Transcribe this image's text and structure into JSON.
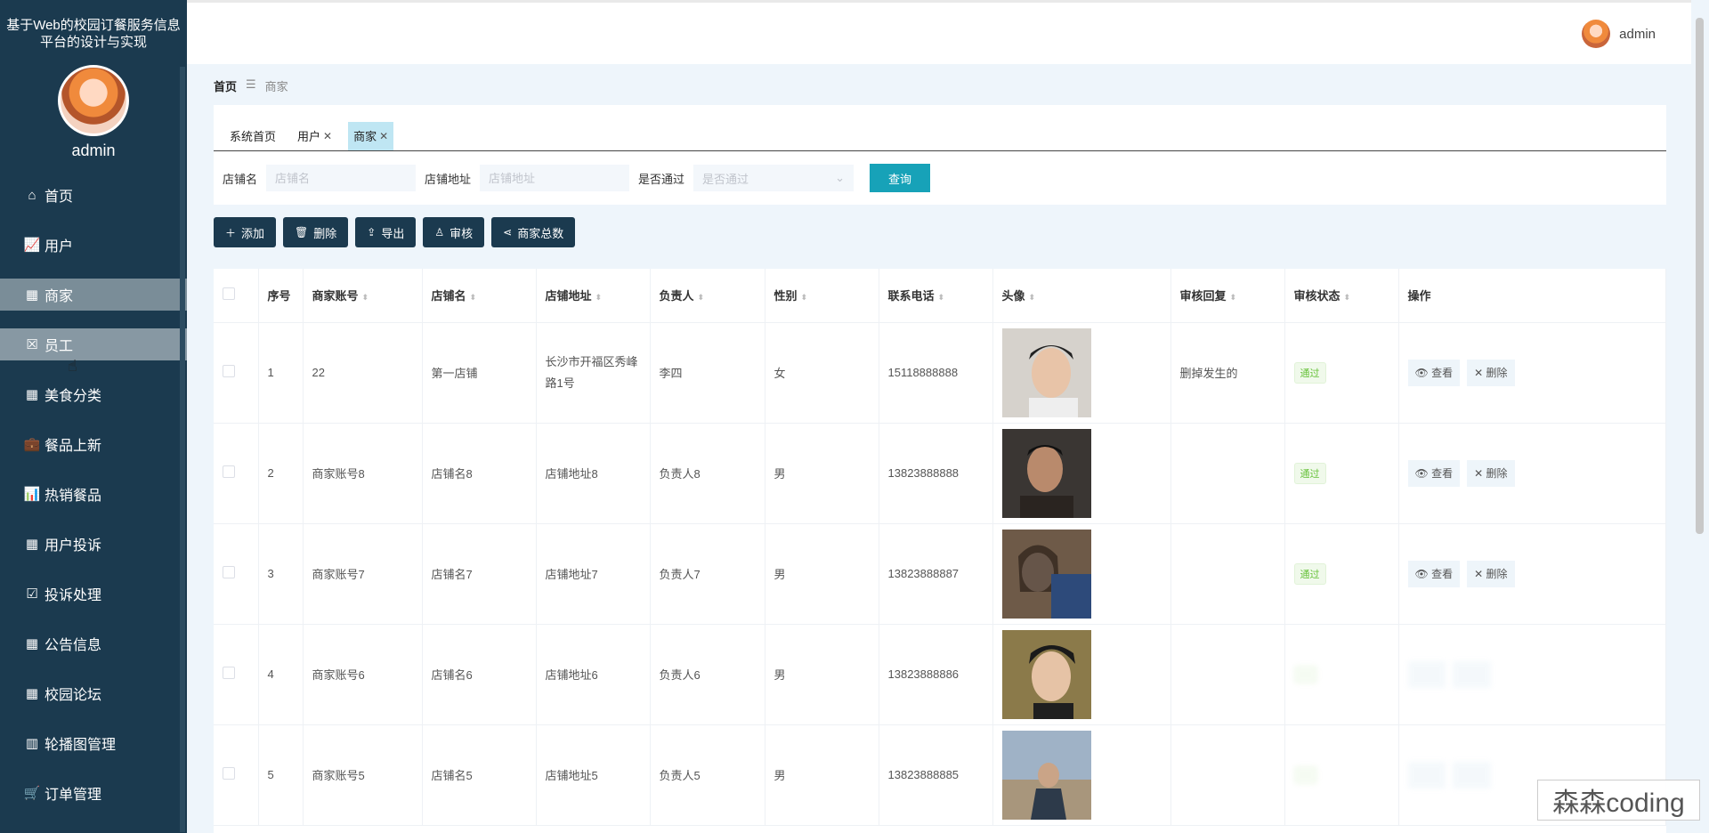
{
  "app": {
    "title": "基于Web的校园订餐服务信息平台的设计与实现",
    "username": "admin"
  },
  "sidebar": {
    "items": [
      {
        "label": "首页",
        "icon": "home-icon"
      },
      {
        "label": "用户",
        "icon": "chart-icon"
      },
      {
        "label": "商家",
        "icon": "grid-icon"
      },
      {
        "label": "员工",
        "icon": "clipboard-icon"
      },
      {
        "label": "美食分类",
        "icon": "grid-icon"
      },
      {
        "label": "餐品上新",
        "icon": "briefcase-icon"
      },
      {
        "label": "热销餐品",
        "icon": "bar-chart-icon"
      },
      {
        "label": "用户投诉",
        "icon": "grid-icon"
      },
      {
        "label": "投诉处理",
        "icon": "check-clipboard-icon"
      },
      {
        "label": "公告信息",
        "icon": "grid-icon"
      },
      {
        "label": "校园论坛",
        "icon": "grid-icon"
      },
      {
        "label": "轮播图管理",
        "icon": "book-icon"
      },
      {
        "label": "订单管理",
        "icon": "cart-icon"
      }
    ]
  },
  "topbar": {
    "username": "admin"
  },
  "breadcrumb": {
    "home": "首页",
    "separator": "☰",
    "current": "商家"
  },
  "tabs": [
    {
      "label": "系统首页",
      "closable": false
    },
    {
      "label": "用户",
      "closable": true
    },
    {
      "label": "商家",
      "closable": true,
      "active": true
    }
  ],
  "search": {
    "shop_name_label": "店铺名",
    "shop_name_placeholder": "店铺名",
    "address_label": "店铺地址",
    "address_placeholder": "店铺地址",
    "approved_label": "是否通过",
    "approved_placeholder": "是否通过",
    "query_button": "查询"
  },
  "actions": {
    "add": "添加",
    "delete": "删除",
    "export": "导出",
    "review": "审核",
    "total": "商家总数"
  },
  "table": {
    "headers": [
      "序号",
      "商家账号",
      "店铺名",
      "店铺地址",
      "负责人",
      "性别",
      "联系电话",
      "头像",
      "审核回复",
      "审核状态",
      "操作"
    ],
    "view_label": "查看",
    "delete_label": "删除",
    "rows": [
      {
        "no": "1",
        "account": "22",
        "shop": "第一店铺",
        "address": "长沙市开福区秀峰路1号",
        "owner": "李四",
        "gender": "女",
        "phone": "15118888888",
        "reply": "删掉发生的",
        "status": "通过"
      },
      {
        "no": "2",
        "account": "商家账号8",
        "shop": "店铺名8",
        "address": "店铺地址8",
        "owner": "负责人8",
        "gender": "男",
        "phone": "13823888888",
        "reply": "",
        "status": "通过"
      },
      {
        "no": "3",
        "account": "商家账号7",
        "shop": "店铺名7",
        "address": "店铺地址7",
        "owner": "负责人7",
        "gender": "男",
        "phone": "13823888887",
        "reply": "",
        "status": "通过"
      },
      {
        "no": "4",
        "account": "商家账号6",
        "shop": "店铺名6",
        "address": "店铺地址6",
        "owner": "负责人6",
        "gender": "男",
        "phone": "13823888886",
        "reply": "",
        "status": ""
      },
      {
        "no": "5",
        "account": "商家账号5",
        "shop": "店铺名5",
        "address": "店铺地址5",
        "owner": "负责人5",
        "gender": "男",
        "phone": "13823888885",
        "reply": "",
        "status": ""
      }
    ]
  },
  "watermark": "森森coding"
}
